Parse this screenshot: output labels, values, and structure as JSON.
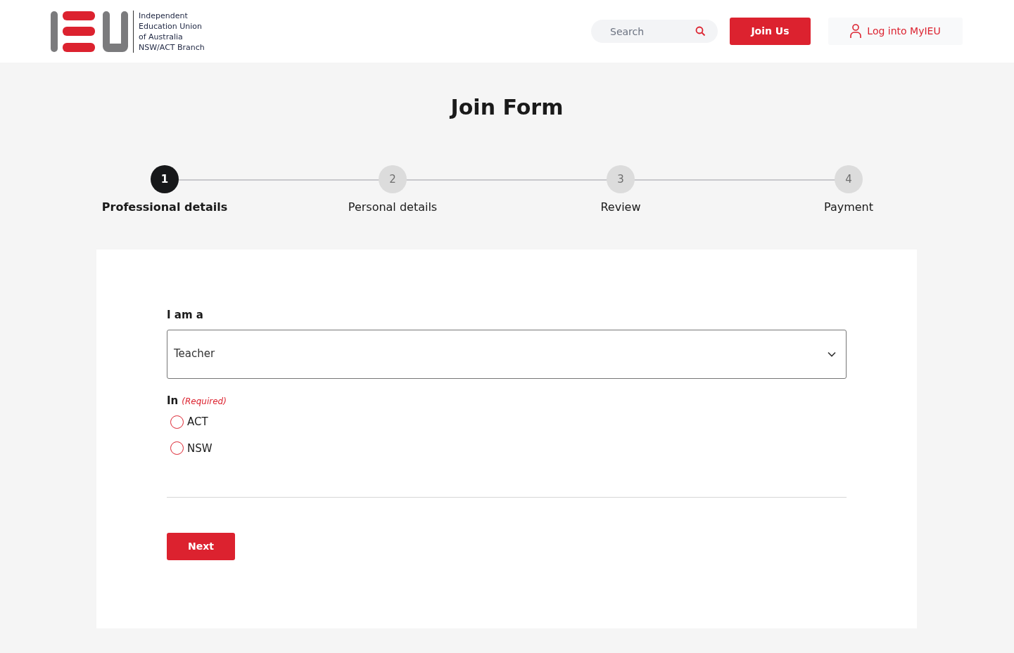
{
  "header": {
    "logo_text": [
      "Independent",
      "Education Union",
      "of Australia",
      "NSW/ACT Branch"
    ],
    "search": {
      "placeholder": "Search"
    },
    "join_button": "Join Us",
    "login_link": "Log into MyIEU"
  },
  "title": "Join Form",
  "steps": [
    {
      "number": "1",
      "label": "Professional details",
      "selected": true
    },
    {
      "number": "2",
      "label": "Personal details",
      "selected": false
    },
    {
      "number": "3",
      "label": "Review",
      "selected": false
    },
    {
      "number": "4",
      "label": "Payment",
      "selected": false
    }
  ],
  "form": {
    "role_label": "I am a",
    "role_value": "Teacher",
    "state_label": "In",
    "state_required": "(Required)",
    "state_options": [
      {
        "label": "ACT",
        "selected": false
      },
      {
        "label": "NSW",
        "selected": false
      }
    ],
    "next_button": "Next"
  }
}
